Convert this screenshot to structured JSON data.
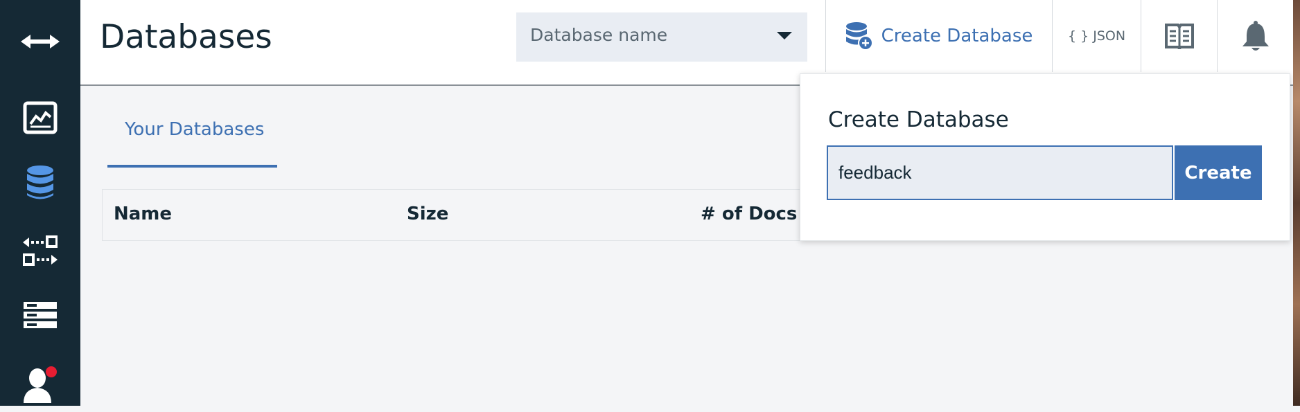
{
  "header": {
    "title": "Databases",
    "db_select_placeholder": "Database name",
    "create_database_label": "Create Database",
    "json_label": "{ } JSON"
  },
  "sidebar": {
    "items": [
      {
        "icon": "double-arrow-icon"
      },
      {
        "icon": "activity-chart-icon"
      },
      {
        "icon": "database-icon",
        "active": true
      },
      {
        "icon": "replication-icon"
      },
      {
        "icon": "server-icon"
      },
      {
        "icon": "user-icon",
        "notification": true
      }
    ]
  },
  "tabs": [
    {
      "label": "Your Databases",
      "active": true
    }
  ],
  "table": {
    "columns": [
      "Name",
      "Size",
      "# of Docs"
    ]
  },
  "popover": {
    "title": "Create Database",
    "input_value": "feedback",
    "button_label": "Create"
  },
  "colors": {
    "sidebar_bg": "#152935",
    "accent": "#3d70b2",
    "active_icon": "#5596e6",
    "notification_dot": "#e71d32"
  }
}
